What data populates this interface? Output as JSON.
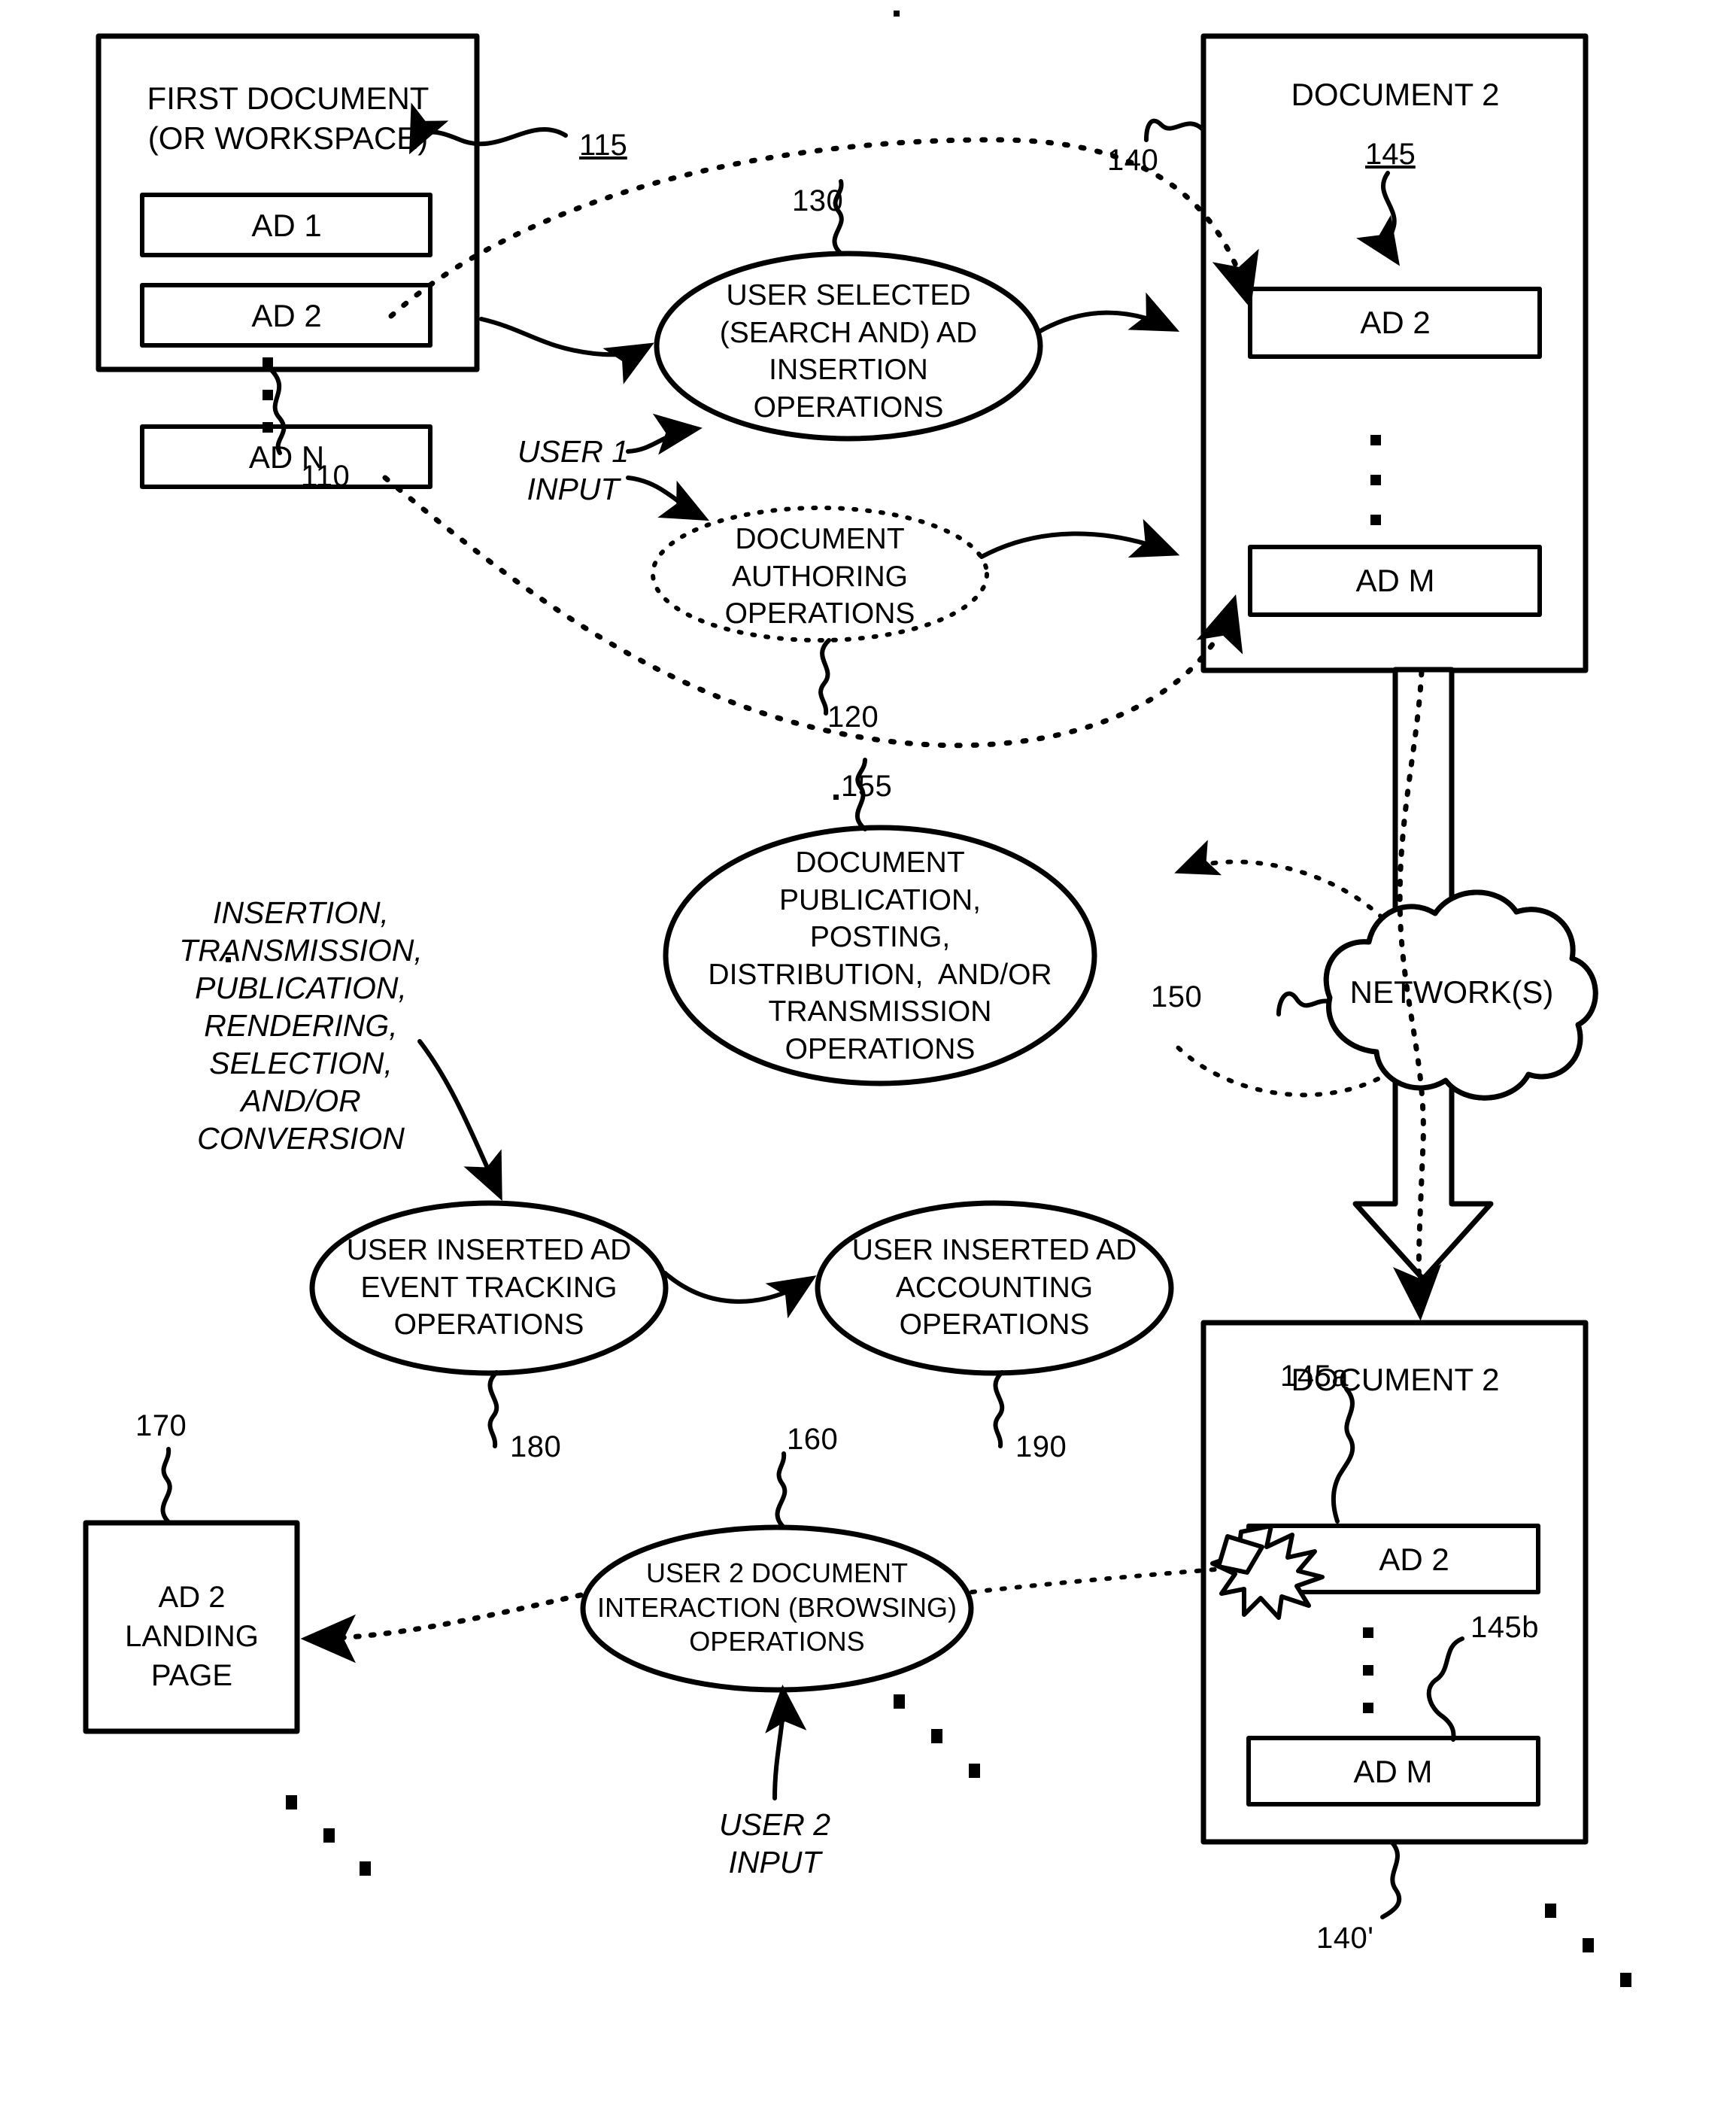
{
  "figure": {
    "type": "patent-flow-diagram",
    "background": "#ffffff",
    "ink": "#000000"
  },
  "first_document": {
    "title_line1": "FIRST DOCUMENT",
    "title_line2": "(OR WORKSPACE)",
    "ref": "110",
    "pointer_ref": "115",
    "ads": [
      {
        "label": "AD 1"
      },
      {
        "label": "AD 2"
      },
      {
        "label": "AD N"
      }
    ],
    "ellipsis": "vertical-dots"
  },
  "operations": {
    "ad_insertion": {
      "ref": "130",
      "line1": "USER SELECTED",
      "line2": "(SEARCH AND) AD",
      "line3": "INSERTION",
      "line4": "OPERATIONS",
      "style": "solid"
    },
    "document_authoring": {
      "ref": "120",
      "line1": "DOCUMENT",
      "line2": "AUTHORING",
      "line3": "OPERATIONS",
      "style": "dotted"
    },
    "publication": {
      "ref": "155",
      "line1": "DOCUMENT",
      "line2": "PUBLICATION,",
      "line3": "POSTING,",
      "line4": "DISTRIBUTION,  AND/OR",
      "line5": "TRANSMISSION",
      "line6": "OPERATIONS",
      "style": "solid"
    },
    "event_tracking": {
      "ref": "180",
      "line1": "USER INSERTED AD",
      "line2": "EVENT TRACKING",
      "line3": "OPERATIONS",
      "style": "solid"
    },
    "accounting": {
      "ref": "190",
      "line1": "USER INSERTED AD",
      "line2": "ACCOUNTING",
      "line3": "OPERATIONS",
      "style": "solid"
    },
    "browsing": {
      "ref": "160",
      "line1": "USER 2 DOCUMENT",
      "line2": "INTERACTION (BROWSING)",
      "line3": "OPERATIONS",
      "style": "solid"
    }
  },
  "inputs": {
    "user1": {
      "line1": "USER 1",
      "line2": "INPUT"
    },
    "user2": {
      "line1": "USER 2",
      "line2": "INPUT"
    }
  },
  "annotation_list": {
    "lines": [
      "INSERTION,",
      "TRANSMISSION,",
      "PUBLICATION,",
      "RENDERING,",
      "SELECTION,",
      "AND/OR",
      "CONVERSION"
    ]
  },
  "document2_top": {
    "title": "DOCUMENT 2",
    "ref": "140",
    "pointer_ref": "145",
    "ads": [
      {
        "label": "AD 2"
      },
      {
        "label": "AD M"
      }
    ],
    "ellipsis": "vertical-dots"
  },
  "document2_bottom": {
    "title": "DOCUMENT 2",
    "ref": "140'",
    "ads": [
      {
        "label": "AD 2",
        "ref": "145a",
        "has_click_burst": true
      },
      {
        "label": "AD M",
        "ref": "145b",
        "has_click_burst": false
      }
    ],
    "ellipsis": "vertical-dots"
  },
  "network": {
    "label": "NETWORK(S)",
    "ref": "150",
    "shape": "cloud"
  },
  "landing_page": {
    "ref": "170",
    "line1": "AD 2",
    "line2": "LANDING",
    "line3": "PAGE"
  }
}
